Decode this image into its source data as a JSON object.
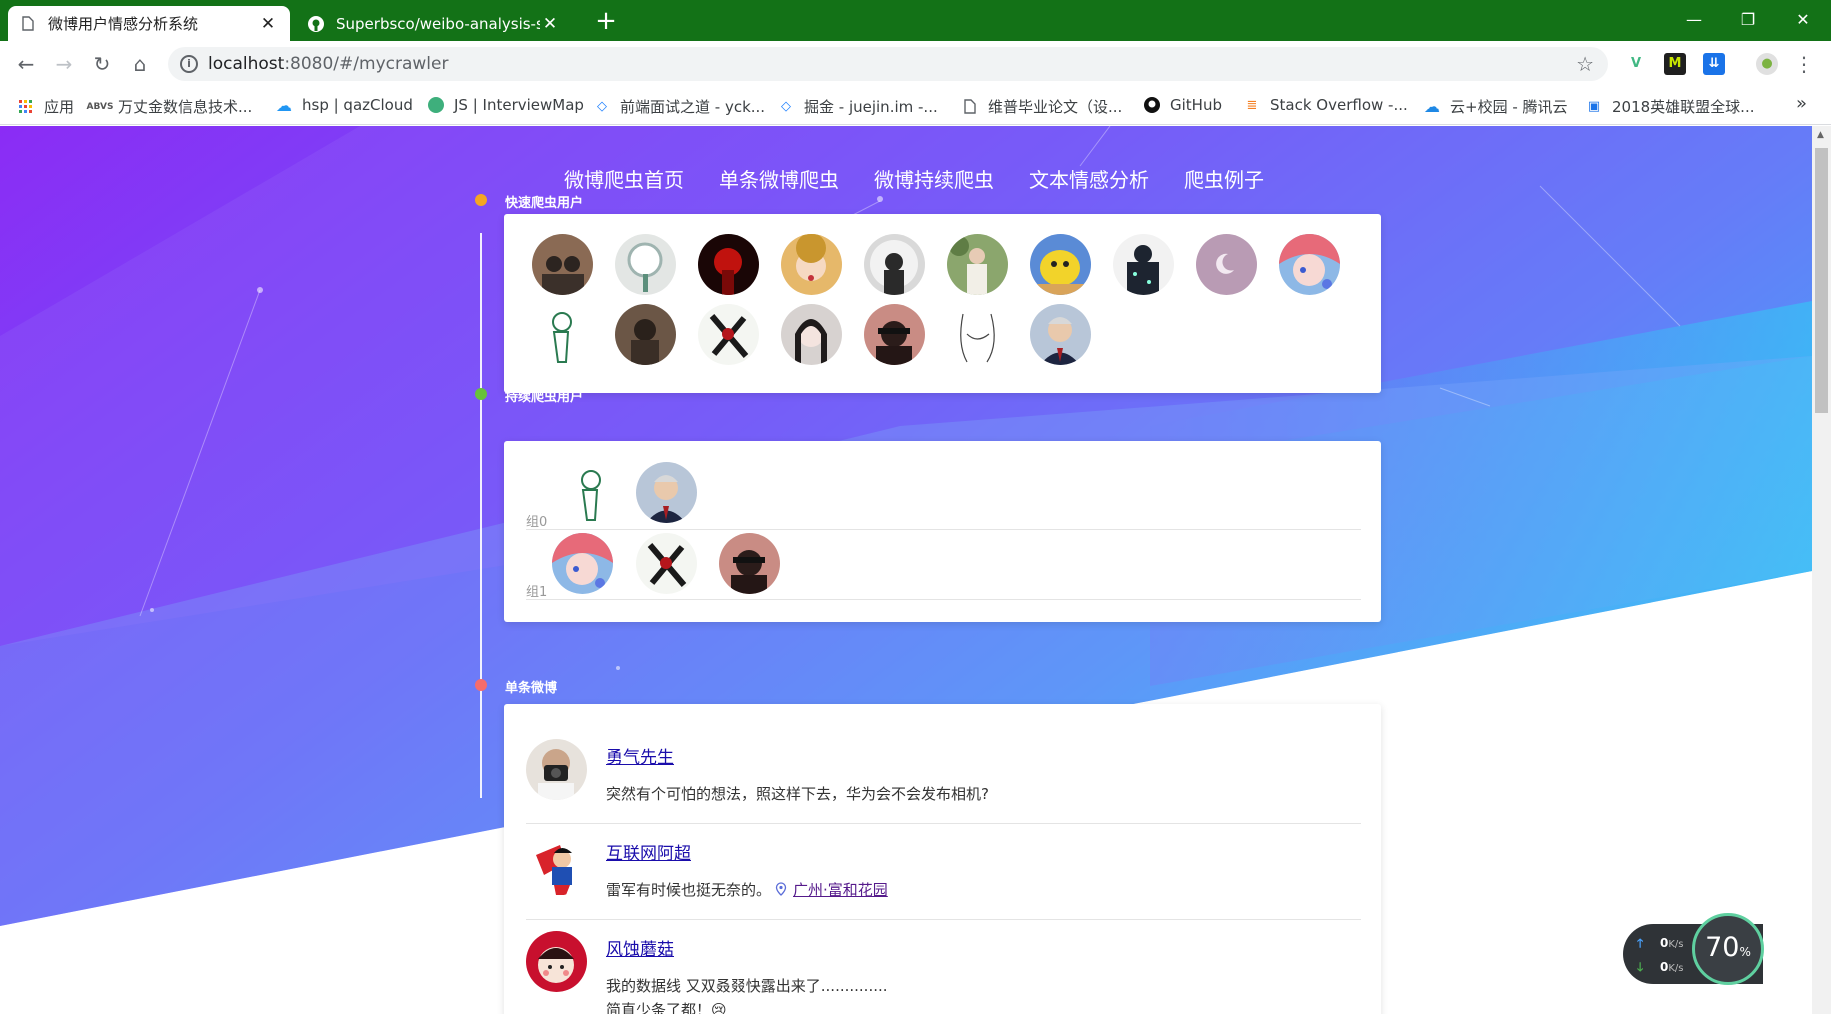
{
  "browser": {
    "tabs": [
      {
        "title": "微博用户情感分析系统",
        "active": true,
        "icon": "page-icon"
      },
      {
        "title": "Superbsco/weibo-analysis-sys",
        "active": false,
        "icon": "github-icon"
      }
    ],
    "new_tab": "+",
    "window_controls": {
      "minimize": "—",
      "restore": "❐",
      "close": "✕"
    },
    "url_host": "localhost",
    "url_path": ":8080/#/mycrawler",
    "bookmarks": [
      {
        "label": "应用",
        "icon": "apps-grid-icon"
      },
      {
        "label": "万丈金数信息技术...",
        "icon": "wanzhang-icon"
      },
      {
        "label": "hsp | qazCloud",
        "icon": "cloud-icon"
      },
      {
        "label": "JS | InterviewMap",
        "icon": "interviewmap-icon"
      },
      {
        "label": "前端面试之道 - yck...",
        "icon": "juejin-icon"
      },
      {
        "label": "掘金 - juejin.im -...",
        "icon": "juejin-icon"
      },
      {
        "label": "维普毕业论文（设...",
        "icon": "page-icon"
      },
      {
        "label": "GitHub",
        "icon": "github-icon"
      },
      {
        "label": "Stack Overflow -...",
        "icon": "stackoverflow-icon"
      },
      {
        "label": "云+校园 - 腾讯云",
        "icon": "tencent-cloud-icon"
      },
      {
        "label": "2018英雄联盟全球...",
        "icon": "calendar-icon"
      }
    ],
    "bookmarks_more": "»"
  },
  "page": {
    "nav": [
      "微博爬虫首页",
      "单条微博爬虫",
      "微博持续爬虫",
      "文本情感分析",
      "爬虫例子"
    ],
    "sections": {
      "quick": {
        "label": "快速爬虫用户",
        "dot_color": "#f5a623"
      },
      "continuous": {
        "label": "持续爬虫用户",
        "dot_color": "#67c23a"
      },
      "single": {
        "label": "单条微博",
        "dot_color": "#f56c6c"
      }
    },
    "quick_users_count": 17,
    "groups": [
      {
        "label": "组0",
        "count": 2
      },
      {
        "label": "组1",
        "count": 3
      }
    ],
    "weibos": [
      {
        "name": "勇气先生",
        "text": "突然有个可怕的想法，照这样下去，华为会不会发布相机?",
        "location": ""
      },
      {
        "name": "互联网阿超",
        "text": "雷军有时候也挺无奈的。",
        "location": "广州·富和花园"
      },
      {
        "name": "风蚀蘑菇",
        "text": "我的数据线 又双叒叕快露出来了..............",
        "text2": "简直少条了都！😢",
        "location": ""
      }
    ]
  },
  "speed_widget": {
    "up": "0",
    "down": "0",
    "unit": "K/s",
    "percent": "70",
    "percent_sign": "%"
  },
  "colors": {
    "titlebar": "#137217",
    "bg_from": "#8a2be2",
    "bg_to": "#1ec8f5"
  }
}
